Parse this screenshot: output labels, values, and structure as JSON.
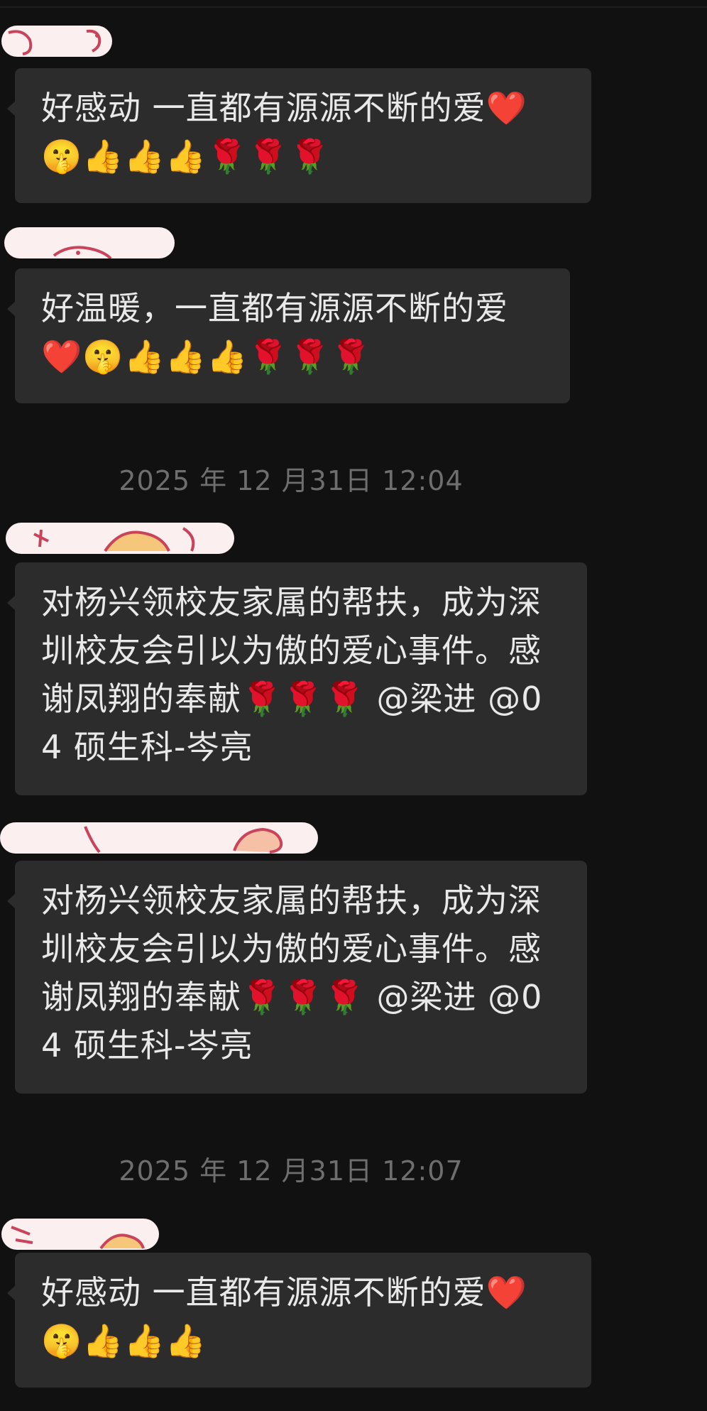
{
  "chat": {
    "timestamps": [
      "2025 年 12 月31日 12:04",
      "2025 年 12 月31日 12:07"
    ],
    "messages": [
      {
        "text": "好感动 一直都有源源不断的爱❤️🤫👍👍👍🌹🌹🌹"
      },
      {
        "text": "好温暖，一直都有源源不断的爱❤️🤫👍👍👍🌹🌹🌹"
      },
      {
        "text": "对杨兴领校友家属的帮扶，成为深圳校友会引以为傲的爱心事件。感谢凤翔的奉献🌹🌹🌹 @梁进 @04 硕生科-岑亮"
      },
      {
        "text": "对杨兴领校友家属的帮扶，成为深圳校友会引以为傲的爱心事件。感谢凤翔的奉献🌹🌹🌹 @梁进 @04 硕生科-岑亮"
      },
      {
        "text": "好感动 一直都有源源不断的爱❤️🤫👍👍👍"
      }
    ]
  },
  "colors": {
    "background": "#111111",
    "bubble": "#2c2c2c",
    "text": "#e9e9e9",
    "timestamp": "#6e6e6e",
    "sender_tag": "#fbeff0",
    "sender_tag_doodle": "#c9445a"
  }
}
